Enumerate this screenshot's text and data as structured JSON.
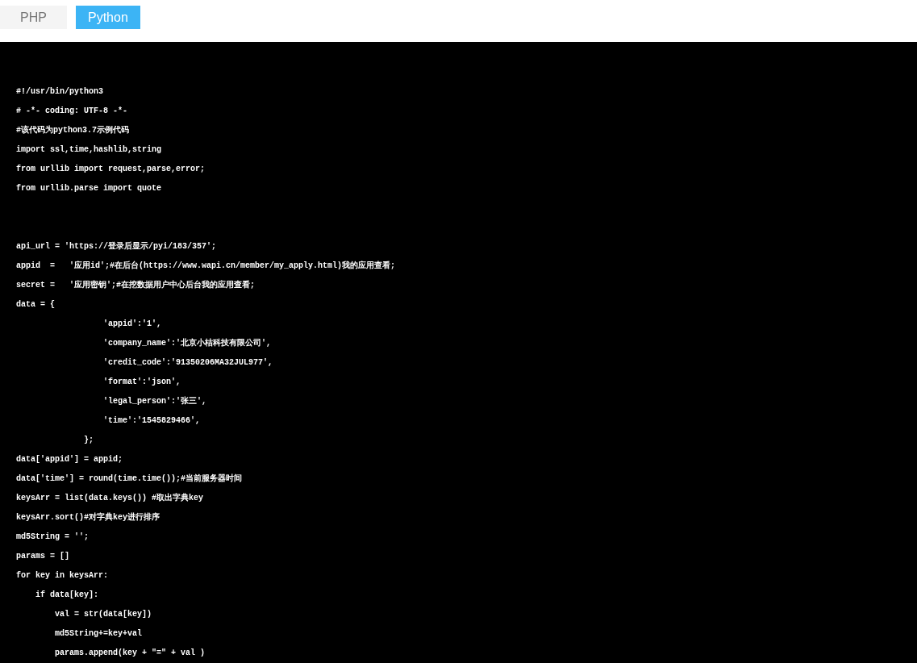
{
  "tabs": [
    {
      "label": "PHP",
      "selected": false
    },
    {
      "label": "Python",
      "selected": true
    }
  ],
  "code_blocks": [
    [
      "#!/usr/bin/python3",
      "# -*- coding: UTF-8 -*-",
      "#该代码为python3.7示例代码",
      "import ssl,time,hashlib,string",
      "from urllib import request,parse,error;",
      "from urllib.parse import quote"
    ],
    [
      "api_url = 'https://登录后显示/pyi/183/357';",
      "appid  =   '应用id';#在后台(https://www.wapi.cn/member/my_apply.html)我的应用查看;",
      "secret =   '应用密钥';#在挖数据用户中心后台我的应用查看;",
      "data = {",
      "                  'appid':'1',",
      "                  'company_name':'北京小桔科技有限公司',",
      "                  'credit_code':'91350206MA32JUL977',",
      "                  'format':'json',",
      "                  'legal_person':'张三',",
      "                  'time':'1545829466',",
      "              };",
      "data['appid'] = appid;",
      "data['time'] = round(time.time());#当前服务器时间",
      "keysArr = list(data.keys()) #取出字典key",
      "keysArr.sort()#对字典key进行排序",
      "md5String = '';",
      "params = []",
      "for key in keysArr:",
      "    if data[key]:",
      "        val = str(data[key])",
      "        md5String+=key+val",
      "        params.append(key + \"=\" + val )"
    ]
  ]
}
